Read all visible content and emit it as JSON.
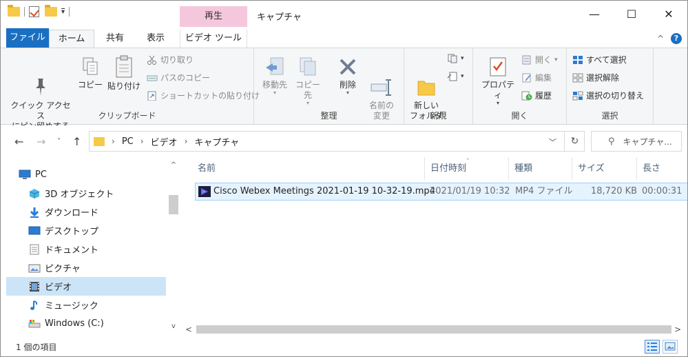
{
  "window": {
    "title": "キャプチャ",
    "context_tab_header": "再生",
    "controls": {
      "minimize": "—",
      "maximize": "☐",
      "close": "✕"
    }
  },
  "ribbon_tabs": {
    "file": "ファイル",
    "home": "ホーム",
    "share": "共有",
    "view": "表示",
    "video_tools": "ビデオ ツール"
  },
  "ribbon": {
    "clipboard": {
      "label": "クリップボード",
      "pin_quick_access": "クイック アクセス\nにピン留めする",
      "copy": "コピー",
      "paste": "貼り付け",
      "cut": "切り取り",
      "copy_path": "パスのコピー",
      "paste_shortcut": "ショートカットの貼り付け"
    },
    "organize": {
      "label": "整理",
      "move_to": "移動先",
      "copy_to": "コピー先",
      "delete": "削除",
      "rename": "名前の\n変更"
    },
    "new": {
      "label": "新規",
      "new_folder": "新しい\nフォルダー"
    },
    "open": {
      "label": "開く",
      "properties": "プロパティ",
      "open": "開く",
      "edit": "編集",
      "history": "履歴"
    },
    "select": {
      "label": "選択",
      "select_all": "すべて選択",
      "select_none": "選択解除",
      "invert_selection": "選択の切り替え"
    }
  },
  "address_bar": {
    "path": [
      "PC",
      "ビデオ",
      "キャプチャ"
    ],
    "search_placeholder": "キャプチャ..."
  },
  "nav_pane": {
    "items": [
      {
        "label": "PC",
        "icon": "pc-icon"
      },
      {
        "label": "3D オブジェクト",
        "icon": "3d-objects-icon"
      },
      {
        "label": "ダウンロード",
        "icon": "download-icon"
      },
      {
        "label": "デスクトップ",
        "icon": "desktop-icon"
      },
      {
        "label": "ドキュメント",
        "icon": "document-icon"
      },
      {
        "label": "ピクチャ",
        "icon": "pictures-icon"
      },
      {
        "label": "ビデオ",
        "icon": "video-folder-icon",
        "selected": true
      },
      {
        "label": "ミュージック",
        "icon": "music-icon"
      },
      {
        "label": "Windows (C:)",
        "icon": "drive-icon"
      }
    ]
  },
  "file_list": {
    "columns": [
      "名前",
      "日付時刻",
      "種類",
      "サイズ",
      "長さ"
    ],
    "rows": [
      {
        "name": "Cisco Webex Meetings 2021-01-19 10-32-19.mp4",
        "date": "2021/01/19 10:32",
        "type": "MP4 ファイル",
        "size": "18,720 KB",
        "length": "00:00:31"
      }
    ]
  },
  "status_bar": {
    "item_count": "1 個の項目"
  },
  "colors": {
    "accent": "#1a6fc2",
    "context_tab": "#f5c7dc",
    "selection": "#cce4f7",
    "row_selection": "#e5f3ff"
  }
}
